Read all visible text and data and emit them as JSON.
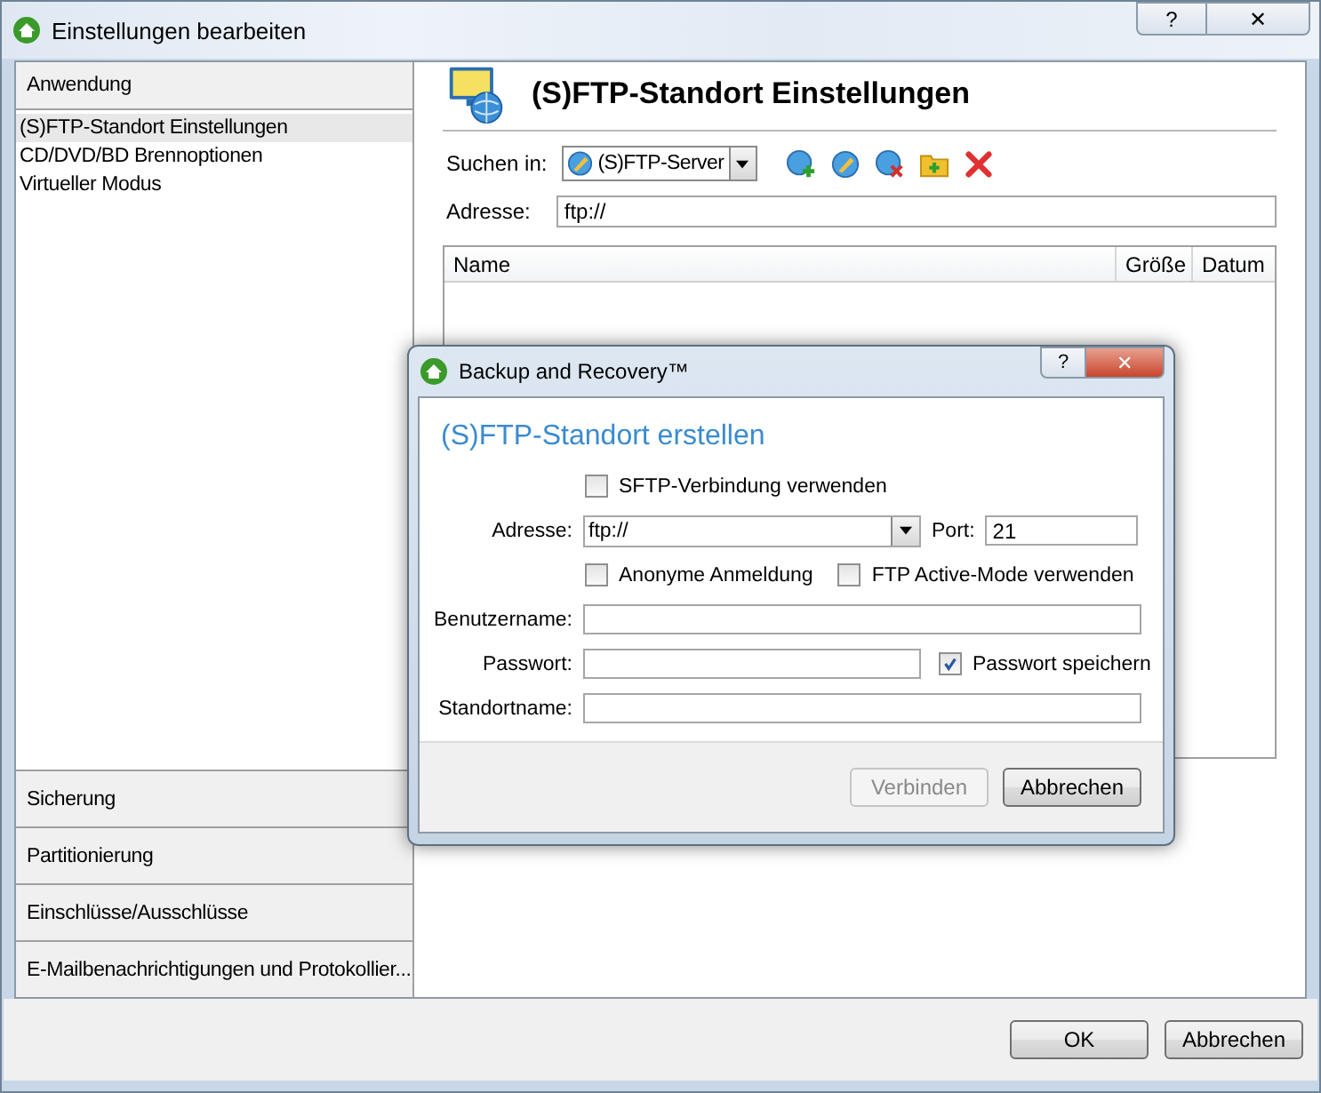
{
  "window": {
    "title": "Einstellungen bearbeiten",
    "help": "?",
    "close": "✕"
  },
  "sidebar": {
    "header": "Anwendung",
    "items": [
      {
        "label": "(S)FTP-Standort Einstellungen",
        "selected": true
      },
      {
        "label": "CD/DVD/BD Brennoptionen",
        "selected": false
      },
      {
        "label": "Virtueller Modus",
        "selected": false
      }
    ],
    "sections": [
      "Sicherung",
      "Partitionierung",
      "Einschlüsse/Ausschlüsse",
      "E-Mailbenachrichtigungen und Protokollier..."
    ]
  },
  "panel": {
    "title": "(S)FTP-Standort Einstellungen",
    "search_label": "Suchen in:",
    "search_value": "(S)FTP-Server",
    "address_label": "Adresse:",
    "address_value": "ftp://",
    "table": {
      "columns": [
        "Name",
        "Größe",
        "Datum"
      ]
    }
  },
  "dialog": {
    "title": "Backup and Recovery™",
    "help": "?",
    "close": "✕",
    "heading": "(S)FTP-Standort erstellen",
    "sftp": {
      "label": "SFTP-Verbindung verwenden",
      "checked": false
    },
    "address_label": "Adresse:",
    "address_value": "ftp://",
    "port_label": "Port:",
    "port_value": "21",
    "anonymous": {
      "label": "Anonyme Anmeldung",
      "checked": false
    },
    "active_mode": {
      "label": "FTP Active-Mode verwenden",
      "checked": false
    },
    "username_label": "Benutzername:",
    "password_label": "Passwort:",
    "save_password": {
      "label": "Passwort speichern",
      "checked": true
    },
    "location_label": "Standortname:",
    "buttons": [
      {
        "label": "Verbinden",
        "disabled": true
      },
      {
        "label": "Abbrechen",
        "disabled": false
      }
    ]
  },
  "buttons": [
    "OK",
    "Abbrechen"
  ]
}
